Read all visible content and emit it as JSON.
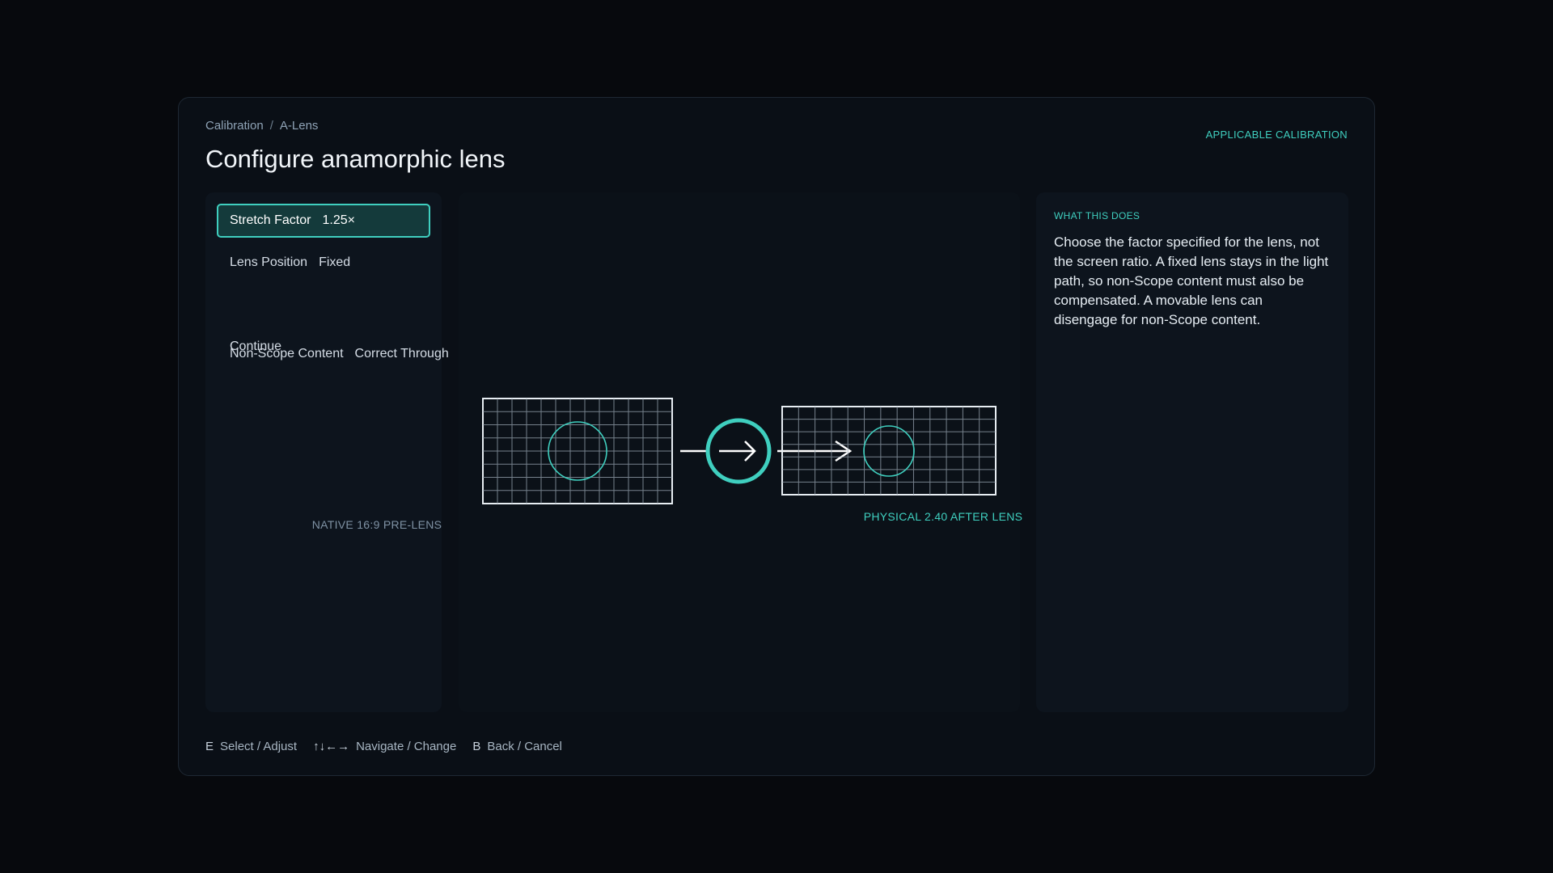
{
  "breadcrumb": [
    "Calibration",
    "A-Lens"
  ],
  "breadcrumb_sep": "/",
  "title": "Configure anamorphic lens",
  "top_badge": "APPLICABLE CALIBRATION",
  "menu": [
    {
      "label": "Stretch Factor",
      "value": "1.25×",
      "active": true
    },
    {
      "label": "Lens Position",
      "value": "Fixed",
      "active": false
    },
    {
      "label": "Non-Scope Content",
      "value": "Correct Through",
      "active": false
    },
    {
      "label": "Continue",
      "value": "",
      "active": false
    }
  ],
  "preview": {
    "native_caption": "NATIVE 16:9 PRE-LENS",
    "physical_caption": "PHYSICAL 2.40 AFTER LENS"
  },
  "info": {
    "label": "WHAT THIS DOES",
    "body": "Choose the factor specified for the lens, not the screen ratio. A fixed lens stays in the light path, so non-Scope content must also be compensated. A movable lens can disengage for non-Scope content."
  },
  "footer": [
    {
      "key": "E",
      "action": "Select / Adjust"
    },
    {
      "key": "↑↓←→",
      "action": "Navigate / Change"
    },
    {
      "key": "B",
      "action": "Back / Cancel"
    }
  ],
  "colors": {
    "accent": "#3fcfbf",
    "background": "#07090d",
    "panel": "#0d141d"
  }
}
